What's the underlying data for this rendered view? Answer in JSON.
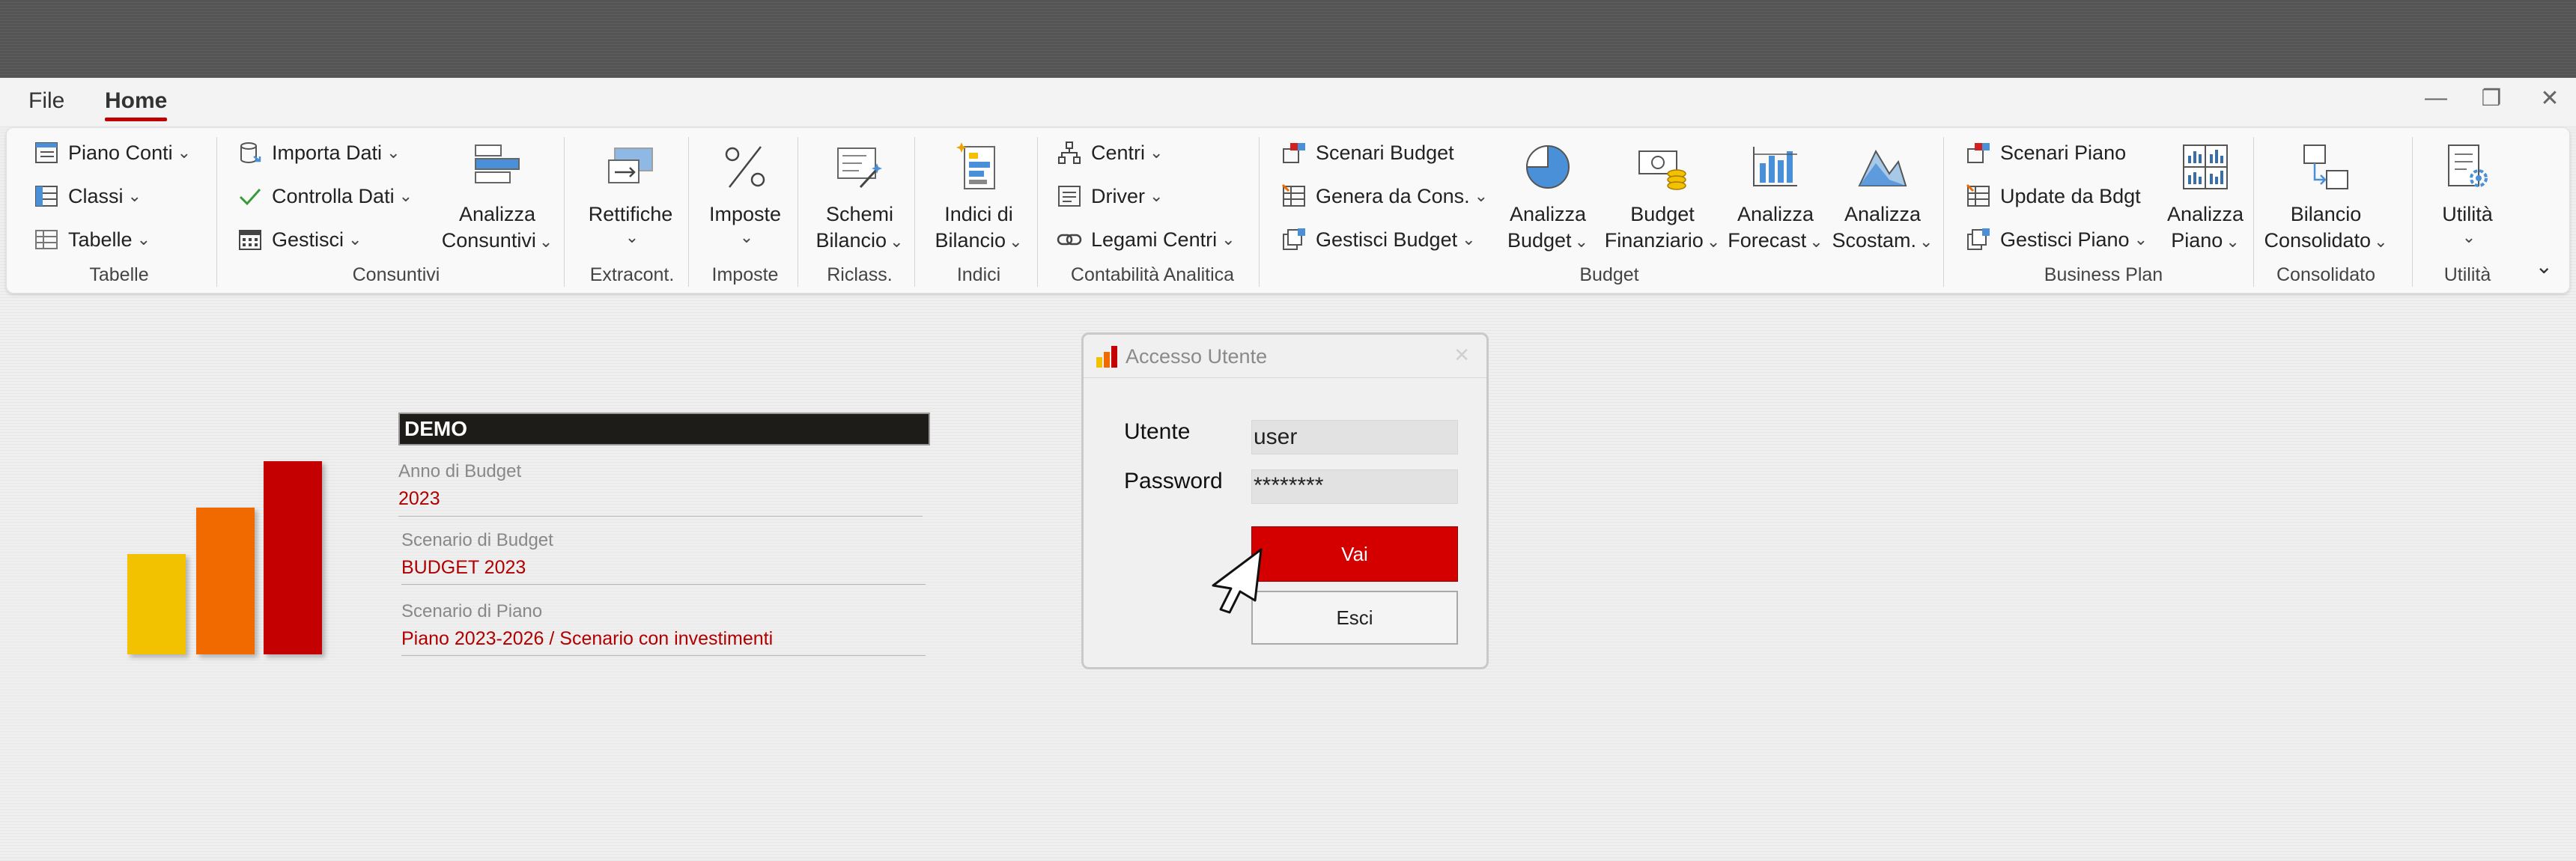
{
  "menubar": {
    "tabs": [
      {
        "label": "File"
      },
      {
        "label": "Home"
      }
    ],
    "window_controls": {
      "minimize": "—",
      "restore": "❐",
      "close": "✕"
    }
  },
  "ribbon": {
    "groups": {
      "tabelle": {
        "label": "Tabelle",
        "buttons": [
          {
            "label": "Piano Conti",
            "icon": "chart-of-accounts-icon"
          },
          {
            "label": "Classi",
            "icon": "classes-icon"
          },
          {
            "label": "Tabelle",
            "icon": "table-icon"
          }
        ]
      },
      "consuntivi": {
        "label": "Consuntivi",
        "buttons": [
          {
            "label": "Importa Dati",
            "icon": "database-import-icon"
          },
          {
            "label": "Controlla Dati",
            "icon": "checkmark-icon"
          },
          {
            "label": "Gestisci",
            "icon": "calendar-icon"
          }
        ],
        "large": {
          "line1": "Analizza",
          "line2": "Consuntivi",
          "icon": "analyze-actuals-icon"
        }
      },
      "extracont": {
        "label": "Extracont.",
        "large": {
          "line1": "Rettifiche",
          "line2": "",
          "icon": "adjustments-icon"
        }
      },
      "imposte": {
        "label": "Imposte",
        "large": {
          "line1": "Imposte",
          "line2": "",
          "icon": "percent-icon"
        }
      },
      "riclass": {
        "label": "Riclass.",
        "large": {
          "line1": "Schemi",
          "line2": "Bilancio",
          "icon": "schema-wand-icon"
        }
      },
      "indici": {
        "label": "Indici",
        "large": {
          "line1": "Indici di",
          "line2": "Bilancio",
          "icon": "ratios-icon"
        }
      },
      "contabilita": {
        "label": "Contabilità Analitica",
        "buttons": [
          {
            "label": "Centri",
            "icon": "org-chart-icon"
          },
          {
            "label": "Driver",
            "icon": "list-icon"
          },
          {
            "label": "Legami Centri",
            "icon": "link-icon"
          }
        ]
      },
      "budget": {
        "label": "Budget",
        "buttons": [
          {
            "label": "Scenari Budget",
            "icon": "scenarios-icon"
          },
          {
            "label": "Genera da Cons.",
            "icon": "generate-icon"
          },
          {
            "label": "Gestisci Budget",
            "icon": "manage-budget-icon"
          }
        ],
        "large": [
          {
            "line1": "Analizza",
            "line2": "Budget",
            "icon": "pie-chart-icon"
          },
          {
            "line1": "Budget",
            "line2": "Finanziario",
            "icon": "money-coins-icon"
          },
          {
            "line1": "Analizza",
            "line2": "Forecast",
            "icon": "bar-chart-icon"
          },
          {
            "line1": "Analizza",
            "line2": "Scostam.",
            "icon": "mountain-chart-icon"
          }
        ]
      },
      "business_plan": {
        "label": "Business Plan",
        "buttons": [
          {
            "label": "Scenari Piano",
            "icon": "scenarios-icon"
          },
          {
            "label": "Update da Bdgt",
            "icon": "update-icon"
          },
          {
            "label": "Gestisci Piano",
            "icon": "manage-plan-icon"
          }
        ],
        "large": {
          "line1": "Analizza",
          "line2": "Piano",
          "icon": "multi-chart-icon"
        }
      },
      "consolidato": {
        "label": "Consolidato",
        "large": {
          "line1": "Bilancio",
          "line2": "Consolidato",
          "icon": "consolidation-icon"
        }
      },
      "utilita": {
        "label": "Utilità",
        "large": {
          "line1": "Utilità",
          "line2": "",
          "icon": "settings-list-icon"
        }
      }
    }
  },
  "main": {
    "company": "DEMO",
    "fields": [
      {
        "label": "Anno di Budget",
        "value": "2023"
      },
      {
        "label": "Scenario di Budget",
        "value": "BUDGET 2023"
      },
      {
        "label": "Scenario di Piano",
        "value": "Piano 2023-2026 / Scenario con investimenti"
      }
    ],
    "logo_colors": [
      "#f2c200",
      "#f06a00",
      "#c40000"
    ]
  },
  "dialog": {
    "title": "Accesso Utente",
    "close": "✕",
    "user_label": "Utente",
    "user_value": "user",
    "password_label": "Password",
    "password_value": "********",
    "ok_label": "Vai",
    "cancel_label": "Esci"
  }
}
